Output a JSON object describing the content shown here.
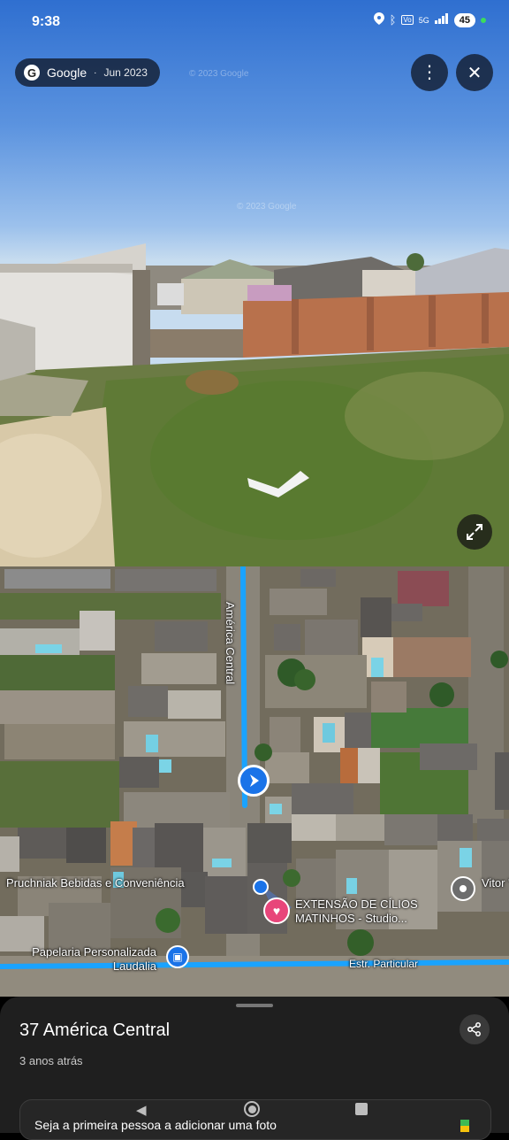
{
  "status_bar": {
    "time": "9:38",
    "network": "5G",
    "battery": "45"
  },
  "streetview": {
    "provider": "Google",
    "date": "Jun 2023",
    "watermark": "© 2023 Google"
  },
  "map": {
    "road_labels": [
      "América Central",
      "Estr. Particular"
    ],
    "pois": [
      {
        "name": "Pruchniak Bebidas e Conveniência"
      },
      {
        "name": "EXTENSÃO DE CÍLIOS MATINHOS - Studio..."
      },
      {
        "name": "Papelaria Personalizada Laudalia"
      },
      {
        "name": "Vitor \"pres"
      }
    ]
  },
  "place": {
    "title": "37 América Central",
    "subtitle": "3 anos atrás",
    "add_photo": "Seja a primeira pessoa a adicionar uma foto"
  },
  "colors": {
    "route": "#1aa3ff",
    "sheet": "#1f1f1f",
    "poi_pink": "#e8457a",
    "poi_blue": "#1a73e8"
  }
}
